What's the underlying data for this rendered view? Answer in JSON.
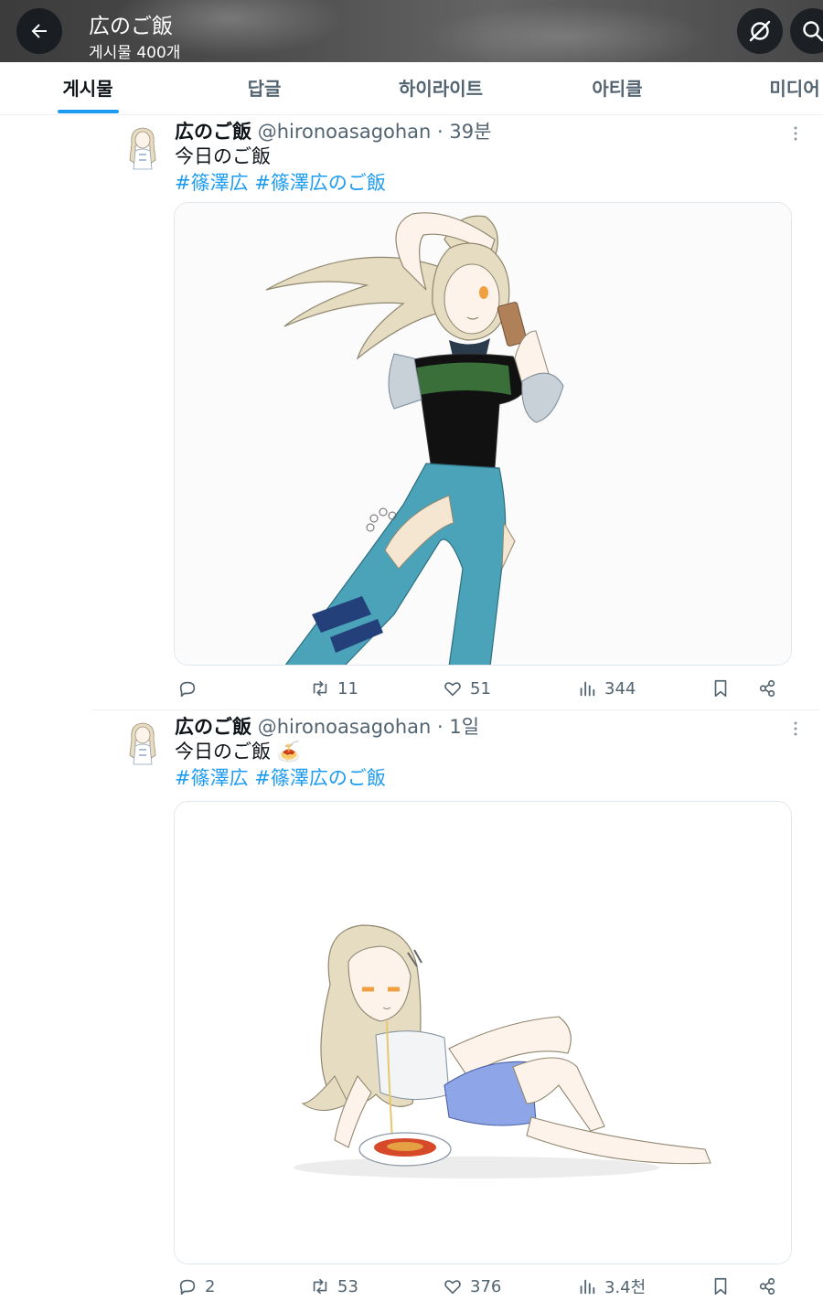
{
  "header": {
    "title": "広のご飯",
    "subtitle": "게시물 400개",
    "back_icon": "arrow-left-icon",
    "grok_icon": "grok-icon",
    "search_icon": "search-icon"
  },
  "tabs": [
    {
      "label": "게시물",
      "active": true
    },
    {
      "label": "답글",
      "active": false
    },
    {
      "label": "하이라이트",
      "active": false
    },
    {
      "label": "아티클",
      "active": false
    },
    {
      "label": "미디어",
      "active": false
    }
  ],
  "colors": {
    "accent": "#1d9bf0",
    "text": "#0f1419",
    "secondary": "#536471"
  },
  "posts": [
    {
      "author": "広のご飯",
      "handle": "@hironoasagohan",
      "separator": "·",
      "time": "39분",
      "text": "今日のご飯",
      "emoji": "",
      "tags": [
        "#篠澤広",
        "#篠澤広のご飯"
      ],
      "media_alt": "illustration of a girl in a black crop top and blue jeans",
      "replies": "",
      "reposts": "11",
      "likes": "51",
      "views": "344"
    },
    {
      "author": "広のご飯",
      "handle": "@hironoasagohan",
      "separator": "·",
      "time": "1일",
      "text": "今日のご飯",
      "emoji": "🍝",
      "tags": [
        "#篠澤広",
        "#篠澤広のご飯"
      ],
      "media_alt": "illustration of a girl lounging next to a plate of spaghetti",
      "replies": "2",
      "reposts": "53",
      "likes": "376",
      "views": "3.4천"
    }
  ]
}
